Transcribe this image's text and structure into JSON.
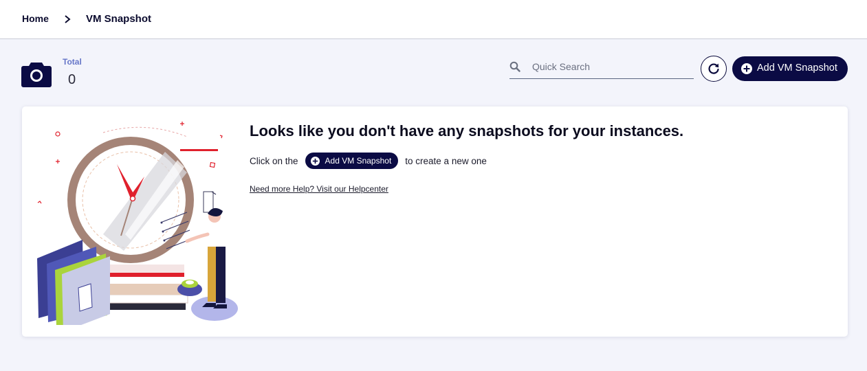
{
  "breadcrumb": {
    "home": "Home",
    "current": "VM Snapshot"
  },
  "stats": {
    "total_label": "Total",
    "total_value": "0"
  },
  "search": {
    "placeholder": "Quick Search",
    "value": ""
  },
  "toolbar": {
    "add_label": "Add VM Snapshot"
  },
  "empty_state": {
    "title": "Looks like you don't have any snapshots for your instances.",
    "hint_prefix": "Click on the",
    "hint_button": "Add VM Snapshot",
    "hint_suffix": "to create a new one",
    "help_link": "Need more Help? Visit our Helpcenter"
  },
  "icons": {
    "breadcrumb_separator": "chevron-right-icon",
    "stat": "camera-icon",
    "search": "search-icon",
    "refresh": "refresh-icon",
    "add": "plus-circle-icon"
  },
  "colors": {
    "primary": "#0b0b44",
    "background": "#f3f4fb",
    "stat_label": "#6676c8",
    "accent_red": "#e0202c"
  }
}
